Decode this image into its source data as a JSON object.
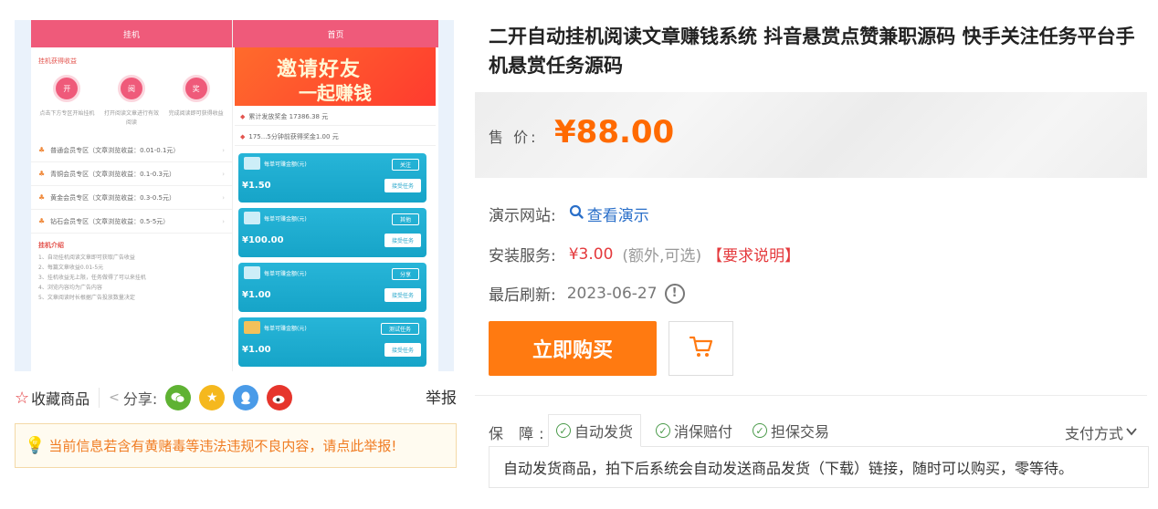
{
  "gallery": {
    "left_phone": {
      "header": "挂机",
      "subtitle": "挂机获得收益",
      "circles": [
        {
          "char": "开",
          "desc": "点击下方专区开始挂机"
        },
        {
          "char": "阅",
          "desc": "打开阅读文章进行有效阅读"
        },
        {
          "char": "奖",
          "desc": "完成阅读即可获得收益"
        }
      ],
      "tiers": [
        "普通会员专区（文章浏览收益：0.01-0.1元）",
        "青铜会员专区（文章浏览收益：0.1-0.3元）",
        "黄金会员专区（文章浏览收益：0.3-0.5元）",
        "钻石会员专区（文章浏览收益：0.5-5元）"
      ],
      "intro_title": "挂机介绍",
      "intro_lines": [
        "1、自动挂机阅读文章即可获取广告收益",
        "2、每篇文章收益0.01-5元",
        "3、挂机收益无上限，任务做得了可以来挂机",
        "4、浏览内容均为广告内容",
        "5、文章阅读时长根据广告投放数量决定"
      ]
    },
    "right_phone": {
      "header": "首页",
      "banner_line1": "邀请好友",
      "banner_line2": "一起赚钱",
      "notice1": "累计发放奖金 17386.38 元",
      "notice2": "175...5分钟前获得奖金1.00 元",
      "tasks": [
        {
          "label": "每单可赚金额(元)",
          "tag": "关注",
          "price": "¥1.50",
          "button": "接受任务"
        },
        {
          "label": "每单可赚金额(元)",
          "tag": "其他",
          "price": "¥100.00",
          "button": "接受任务"
        },
        {
          "label": "每单可赚金额(元)",
          "tag": "分享",
          "price": "¥1.00",
          "button": "接受任务"
        },
        {
          "label": "每单可赚金额(元)",
          "tag": "测试任务",
          "price": "¥1.00",
          "button": "接受任务"
        }
      ]
    }
  },
  "actions": {
    "favorite": "收藏商品",
    "share": "分享:",
    "report": "举报"
  },
  "warning": "当前信息若含有黄赌毒等违法违规不良内容，请点此举报!",
  "product": {
    "title": "二开自动挂机阅读文章赚钱系统 抖音悬赏点赞兼职源码 快手关注任务平台手机悬赏任务源码",
    "price_label": "售 价:",
    "price": "¥88.00",
    "demo_label": "演示网站:",
    "demo_link": "查看演示",
    "install_label": "安装服务:",
    "install_price": "¥3.00",
    "install_note": "(额外,可选)",
    "install_req": "【要求说明】",
    "refresh_label": "最后刷新:",
    "refresh_date": "2023-06-27",
    "buy_button": "立即购买"
  },
  "guarantee": {
    "label": "保 障:",
    "tabs": [
      "自动发货",
      "消保赔付",
      "担保交易"
    ],
    "pay_method": "支付方式",
    "description": "自动发货商品，拍下后系统会自动发送商品发货（下载）链接，随时可以购买，零等待。"
  },
  "colors": {
    "accent": "#ff7a11",
    "price": "#ff6a00",
    "link": "#2a6fc9",
    "red": "#e4393c"
  }
}
